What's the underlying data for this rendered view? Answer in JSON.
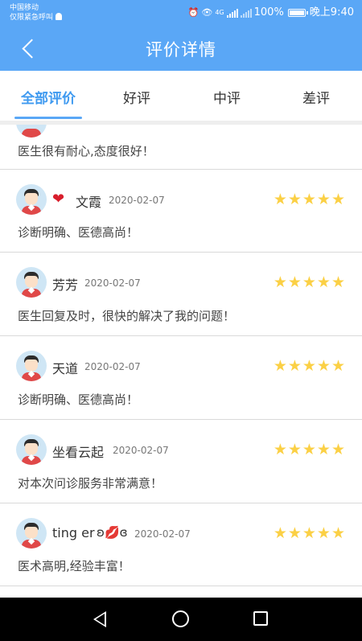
{
  "status_bar": {
    "carrier": "中国移动",
    "emergency": "仅限紧急呼叫",
    "network": "4G",
    "battery": "100%",
    "time": "晚上9:40"
  },
  "header": {
    "title": "评价详情"
  },
  "tabs": [
    {
      "label": "全部评价",
      "active": true
    },
    {
      "label": "好评",
      "active": false
    },
    {
      "label": "中评",
      "active": false
    },
    {
      "label": "差评",
      "active": false
    }
  ],
  "reviews": [
    {
      "name": "",
      "date": "",
      "content": "医生很有耐心,态度很好！",
      "rating": 5
    },
    {
      "name": "文霞",
      "name_prefix": "❤",
      "date": "2020-02-07",
      "content": "诊断明确、医德高尚！",
      "rating": 5
    },
    {
      "name": "芳芳",
      "date": "2020-02-07",
      "content": "医生回复及时，很快的解决了我的问题！",
      "rating": 5
    },
    {
      "name": "天道",
      "date": "2020-02-07",
      "content": "诊断明确、医德高尚！",
      "rating": 5
    },
    {
      "name": "坐看云起",
      "date": "2020-02-07",
      "content": "对本次问诊服务非常满意！",
      "rating": 5
    },
    {
      "name": "ting er",
      "name_suffix_left": "ʚ",
      "name_suffix_mid": "💋",
      "name_suffix_right": "ɞ",
      "date": "2020-02-07",
      "content": "医术高明,经验丰富！",
      "rating": 5
    }
  ],
  "colors": {
    "accent": "#5aa7f6",
    "active_tab": "#3f9af0",
    "star": "#fbd045"
  },
  "stars_text": "★★★★★"
}
